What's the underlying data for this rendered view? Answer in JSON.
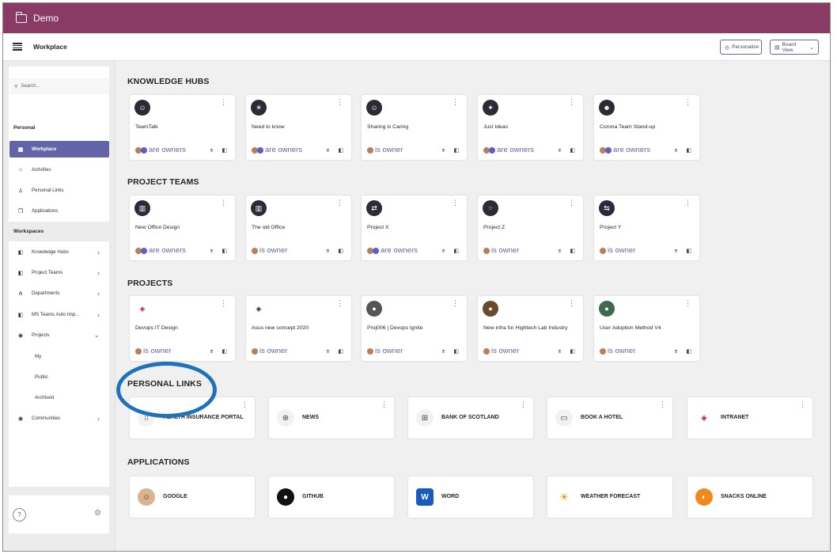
{
  "window": {
    "title": "Demo"
  },
  "header": {
    "title": "Workplace",
    "personalize": "Personalize",
    "board_view": "Board View"
  },
  "sidebar": {
    "search_placeholder": "Search...",
    "personal_label": "Personal",
    "personal_items": [
      {
        "label": "Workplace",
        "icon": "grid-icon"
      },
      {
        "label": "Activities",
        "icon": "home-icon"
      },
      {
        "label": "Personal Links",
        "icon": "person-icon"
      },
      {
        "label": "Applications",
        "icon": "apps-icon"
      }
    ],
    "workspaces_label": "Workspaces",
    "workspace_items": [
      {
        "label": "Knowledge Hubs"
      },
      {
        "label": "Project Teams"
      },
      {
        "label": "Departments"
      },
      {
        "label": "MS Teams Auto Imp..."
      },
      {
        "label": "Projects"
      }
    ],
    "project_subitems": [
      "My",
      "Public",
      "Archived"
    ],
    "communities": "Communities"
  },
  "sections": {
    "knowledge_hubs": "KNOWLEDGE HUBS",
    "project_teams": "PROJECT TEAMS",
    "projects": "PROJECTS",
    "personal_links": "PERSONAL LINKS",
    "applications": "APPLICATIONS"
  },
  "knowledge_hubs": [
    {
      "name": "TeamTalk",
      "owners": "are owners"
    },
    {
      "name": "Need to know",
      "owners": "are owners"
    },
    {
      "name": "Sharing is Caring",
      "owners": "is owner"
    },
    {
      "name": "Just Ideas",
      "owners": "are owners"
    },
    {
      "name": "Corona Team Stand-up",
      "owners": "are owners"
    }
  ],
  "project_teams": [
    {
      "name": "New Office Design",
      "owners": "are owners"
    },
    {
      "name": "The old Office",
      "owners": "is owner"
    },
    {
      "name": "Project X",
      "owners": "are owners"
    },
    {
      "name": "Project Z",
      "owners": "is owner"
    },
    {
      "name": "Project Y",
      "owners": "is owner"
    }
  ],
  "projects": [
    {
      "name": "Devops IT Design",
      "owners": "is owner"
    },
    {
      "name": "Asus new concept 2020",
      "owners": "is owner"
    },
    {
      "name": "Proj006 | Devops Ignite",
      "owners": "is owner"
    },
    {
      "name": "New infra for Hightech Lab Industry",
      "owners": "is owner"
    },
    {
      "name": "User Adoption Method V4",
      "owners": "is owner"
    }
  ],
  "personal_links": [
    {
      "label": "HEALTH INSURANCE PORTAL"
    },
    {
      "label": "NEWS"
    },
    {
      "label": "BANK OF SCOTLAND"
    },
    {
      "label": "BOOK A HOTEL"
    },
    {
      "label": "INTRANET"
    }
  ],
  "applications": [
    {
      "label": "GOOGLE"
    },
    {
      "label": "GITHUB"
    },
    {
      "label": "WORD"
    },
    {
      "label": "WEATHER FORECAST"
    },
    {
      "label": "SNACKS ONLINE"
    }
  ],
  "colors": {
    "titlebar": "#8a3b65",
    "accent": "#6264a7",
    "highlight_ring": "#1e72bb"
  }
}
